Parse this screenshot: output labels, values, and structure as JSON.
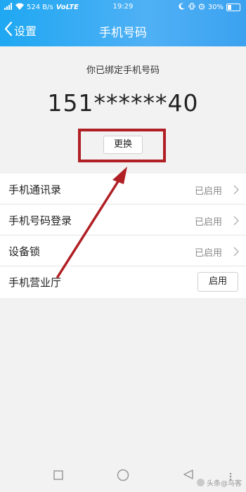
{
  "status_bar": {
    "network_speed": "524 B/s",
    "volte": "VoLTE",
    "time": "19:29",
    "battery": "30%"
  },
  "header": {
    "back_label": "设置",
    "title": "手机号码",
    "background": "#3ba2f0"
  },
  "bound_info": {
    "label": "你已绑定手机号码",
    "phone_number": "151******40",
    "change_button": "更换"
  },
  "settings_list": [
    {
      "label": "手机通讯录",
      "status": "已启用"
    },
    {
      "label": "手机号码登录",
      "status": "已启用"
    },
    {
      "label": "设备锁",
      "status": "已启用"
    },
    {
      "label": "手机营业厅",
      "button": "启用"
    }
  ],
  "annotation": {
    "highlight_color": "#b01f24"
  },
  "watermark": "头条@鸟客"
}
